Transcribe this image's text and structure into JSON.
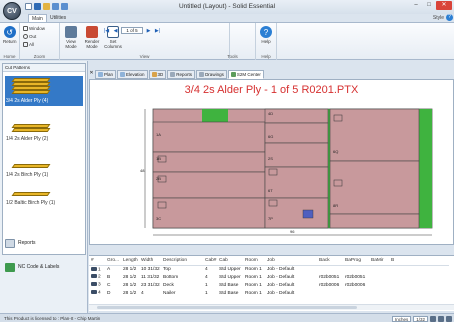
{
  "app": {
    "logo": "CV",
    "title": "Untitled (Layout) - Solid Essential",
    "style_label": "Style",
    "help_glyph": "?"
  },
  "ribbon_tabs": [
    "Main",
    "Utilities"
  ],
  "ribbon": {
    "return_label": "Return",
    "window_label": "Window",
    "out_label": "Out",
    "all_label": "All",
    "view_mode_label": "View Mode",
    "render_mode_label": "Render Mode",
    "set_columns_label": "Set Columns",
    "pager_value": "1 of 5",
    "help_label": "Help",
    "groups": [
      "Home",
      "Zoom",
      "View",
      "Tools",
      "Help"
    ]
  },
  "left_panel": {
    "header": "Cut Patterns",
    "patterns": [
      {
        "label": "3/4 2s Alder Ply (4)",
        "selected": true
      },
      {
        "label": "1/4 2s Alder Ply (2)",
        "selected": false
      },
      {
        "label": "1/4 2s Birch Ply (1)",
        "selected": false
      },
      {
        "label": "1/2 Baltic Birch Ply (1)",
        "selected": false
      }
    ],
    "reports_label": "Reports",
    "nc_label": "NC Code & Labels"
  },
  "doc_tabs": [
    "Plan",
    "Elevation",
    "3D",
    "Reports",
    "Drawings",
    "S2M Center"
  ],
  "drawing": {
    "title": "3/4 2s Alder Ply - 1 of 5 R0201.PTX",
    "width_dim": "96",
    "height_dim": "48",
    "part_labels": [
      "1A",
      "1B",
      "2B",
      "3C",
      "4D",
      "6Q",
      "6T",
      "8R",
      "2S",
      "7P",
      "6G"
    ]
  },
  "table": {
    "columns": [
      "#",
      "Gro...",
      "Length",
      "Width",
      "Description",
      "Cab#",
      "Cab",
      "Room",
      "Job",
      "Back",
      "BaProg",
      "BaMir",
      "B"
    ],
    "rows": [
      [
        "1",
        "A",
        "28 1/2",
        "10 31/32",
        "Top",
        "4",
        "Std Upper",
        "Room 1",
        "Job - Default",
        "",
        "",
        "",
        ""
      ],
      [
        "2",
        "B",
        "28 1/2",
        "11 31/32",
        "Bottom",
        "4",
        "Std Upper",
        "Room 1",
        "Job - Default",
        "r02b0051",
        "r02b0051",
        "",
        ""
      ],
      [
        "3",
        "C",
        "28 1/2",
        "23 31/32",
        "Deck",
        "1",
        "Std Base",
        "Room 1",
        "Job - Default",
        "r02b0006",
        "r02b0006",
        "",
        ""
      ],
      [
        "4",
        "D",
        "28 1/2",
        "4",
        "Nailer",
        "1",
        "Std Base",
        "Room 1",
        "Job - Default",
        "",
        "",
        "",
        ""
      ]
    ]
  },
  "status": {
    "license": "This Product is licensed to : Plan-It - Chip Martin",
    "units": "Inches",
    "scale": "1/32"
  },
  "colors": {
    "part_fill": "#c8999c",
    "scrap_green": "#3fb33f",
    "title_red": "#d63030",
    "selection_blue": "#3479c7"
  }
}
